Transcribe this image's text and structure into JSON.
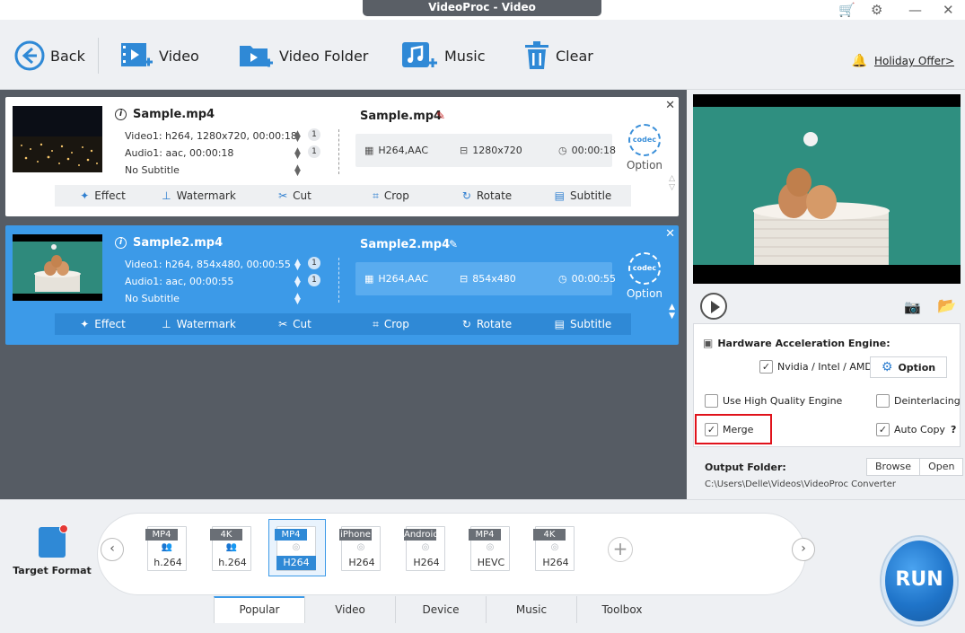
{
  "window": {
    "title": "VideoProc - Video"
  },
  "toolbar": {
    "back": "Back",
    "video": "Video",
    "video_folder": "Video Folder",
    "music": "Music",
    "clear": "Clear",
    "holiday_offer": "Holiday Offer>"
  },
  "items": [
    {
      "name": "Sample.mp4",
      "video_track": "Video1: h264, 1280x720, 00:00:18",
      "audio_track": "Audio1: aac, 00:00:18",
      "subtitle": "No Subtitle",
      "video_count": "1",
      "audio_count": "1",
      "output_name": "Sample.mp4",
      "codec": "H264,AAC",
      "resolution": "1280x720",
      "duration": "00:00:18",
      "option": "Option",
      "codec_icon": "codec",
      "selected": false
    },
    {
      "name": "Sample2.mp4",
      "video_track": "Video1: h264, 854x480, 00:00:55",
      "audio_track": "Audio1: aac, 00:00:55",
      "subtitle": "No Subtitle",
      "video_count": "1",
      "audio_count": "1",
      "output_name": "Sample2.mp4",
      "codec": "H264,AAC",
      "resolution": "854x480",
      "duration": "00:00:55",
      "option": "Option",
      "codec_icon": "codec",
      "selected": true
    }
  ],
  "edit_actions": [
    "Effect",
    "Watermark",
    "Cut",
    "Crop",
    "Rotate",
    "Subtitle"
  ],
  "settings": {
    "hw_title": "Hardware Acceleration Engine:",
    "hw_option": "Nvidia / Intel / AMD",
    "hw_checked": true,
    "option_button": "Option",
    "high_quality": "Use High Quality Engine",
    "high_quality_checked": false,
    "deinterlacing": "Deinterlacing",
    "deinterlacing_checked": false,
    "merge": "Merge",
    "merge_checked": true,
    "auto_copy": "Auto Copy",
    "auto_copy_checked": true,
    "auto_copy_help": "?",
    "output_folder_label": "Output Folder:",
    "browse": "Browse",
    "open": "Open",
    "output_path": "C:\\Users\\Delle\\Videos\\VideoProc Converter"
  },
  "target_format": {
    "label": "Target Format"
  },
  "formats": [
    {
      "top": "MP4",
      "bottom": "h.264",
      "selected": false
    },
    {
      "top": "4K",
      "bottom": "h.264",
      "selected": false
    },
    {
      "top": "MP4",
      "bottom": "H264",
      "selected": true
    },
    {
      "top": "iPhone",
      "bottom": "H264",
      "selected": false
    },
    {
      "top": "Android",
      "bottom": "H264",
      "selected": false
    },
    {
      "top": "MP4",
      "bottom": "HEVC",
      "selected": false
    },
    {
      "top": "4K",
      "bottom": "H264",
      "selected": false
    }
  ],
  "tabs": [
    "Popular",
    "Video",
    "Device",
    "Music",
    "Toolbox"
  ],
  "active_tab": "Popular",
  "run_label": "RUN",
  "colors": {
    "accent": "#3c9ae8",
    "highlight": "#e0121b",
    "panel": "#565c64"
  }
}
